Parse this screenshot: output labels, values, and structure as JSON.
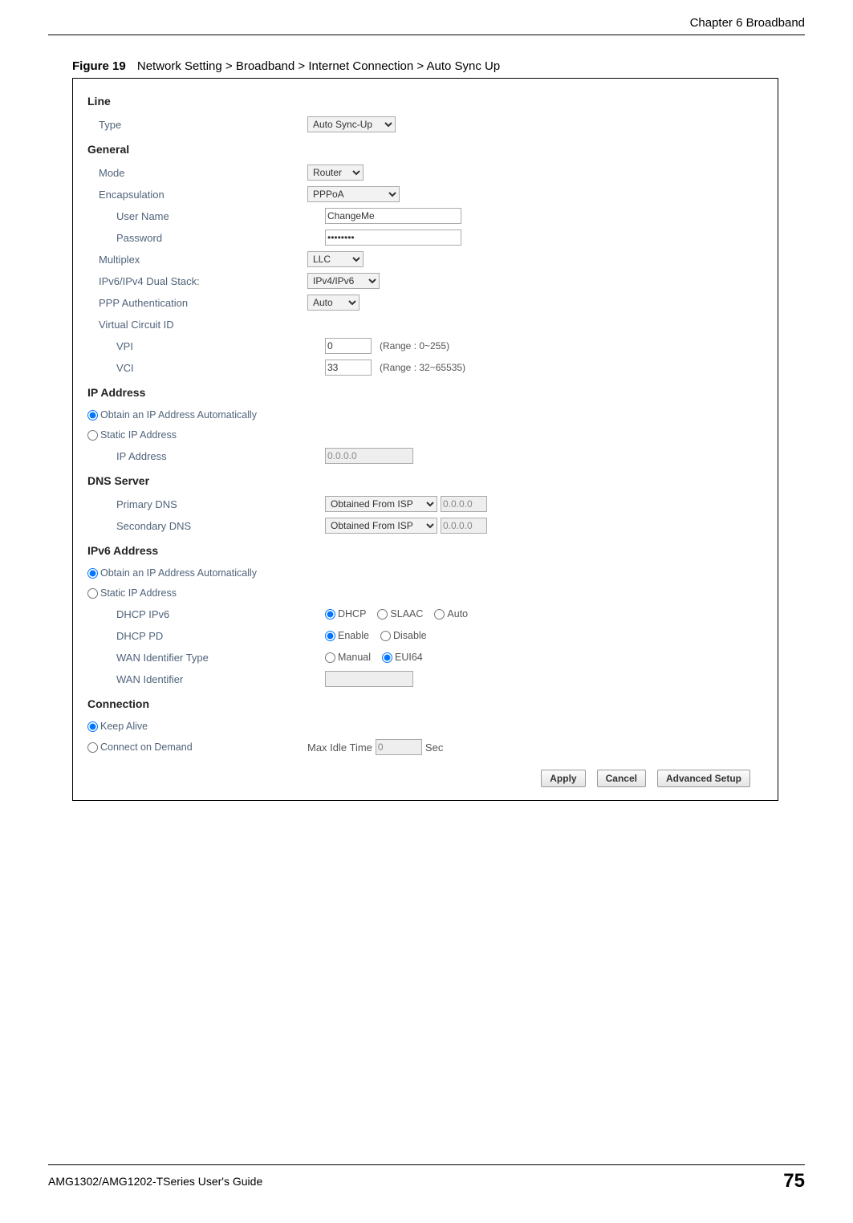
{
  "page": {
    "chapter_header": "Chapter 6 Broadband",
    "footer_left": "AMG1302/AMG1202-TSeries User's Guide",
    "footer_right": "75"
  },
  "figure": {
    "label": "Figure 19",
    "caption": "Network Setting > Broadband > Internet Connection > Auto Sync Up"
  },
  "form": {
    "line": {
      "title": "Line",
      "type_label": "Type",
      "type_value": "Auto Sync-Up"
    },
    "general": {
      "title": "General",
      "mode_label": "Mode",
      "mode_value": "Router",
      "encap_label": "Encapsulation",
      "encap_value": "PPPoA",
      "user_label": "User Name",
      "user_value": "ChangeMe",
      "pass_label": "Password",
      "pass_value": "••••••••",
      "mux_label": "Multiplex",
      "mux_value": "LLC",
      "dual_label": "IPv6/IPv4 Dual Stack:",
      "dual_value": "IPv4/IPv6",
      "ppp_auth_label": "PPP Authentication",
      "ppp_auth_value": "Auto",
      "vcid_label": "Virtual Circuit ID",
      "vpi_label": "VPI",
      "vpi_value": "0",
      "vpi_hint": "(Range : 0~255)",
      "vci_label": "VCI",
      "vci_value": "33",
      "vci_hint": "(Range : 32~65535)"
    },
    "ip": {
      "title": "IP Address",
      "auto_label": "Obtain an IP Address Automatically",
      "static_label": "Static IP Address",
      "ipaddr_label": "IP Address",
      "ipaddr_value": "0.0.0.0"
    },
    "dns": {
      "title": "DNS Server",
      "primary_label": "Primary DNS",
      "secondary_label": "Secondary DNS",
      "source_value": "Obtained From ISP",
      "addr_value": "0.0.0.0"
    },
    "ipv6": {
      "title": "IPv6 Address",
      "auto_label": "Obtain an IP Address Automatically",
      "static_label": "Static IP Address",
      "dhcp_ipv6_label": "DHCP IPv6",
      "opt_dhcp": "DHCP",
      "opt_slaac": "SLAAC",
      "opt_auto": "Auto",
      "dhcp_pd_label": "DHCP PD",
      "opt_enable": "Enable",
      "opt_disable": "Disable",
      "wan_id_type_label": "WAN Identifier Type",
      "opt_manual": "Manual",
      "opt_eui64": "EUI64",
      "wan_id_label": "WAN Identifier"
    },
    "conn": {
      "title": "Connection",
      "keep_alive_label": "Keep Alive",
      "cod_label": "Connect on Demand",
      "max_idle_label": "Max Idle Time",
      "max_idle_value": "0",
      "max_idle_unit": "Sec"
    },
    "buttons": {
      "apply": "Apply",
      "cancel": "Cancel",
      "advanced": "Advanced Setup"
    }
  }
}
